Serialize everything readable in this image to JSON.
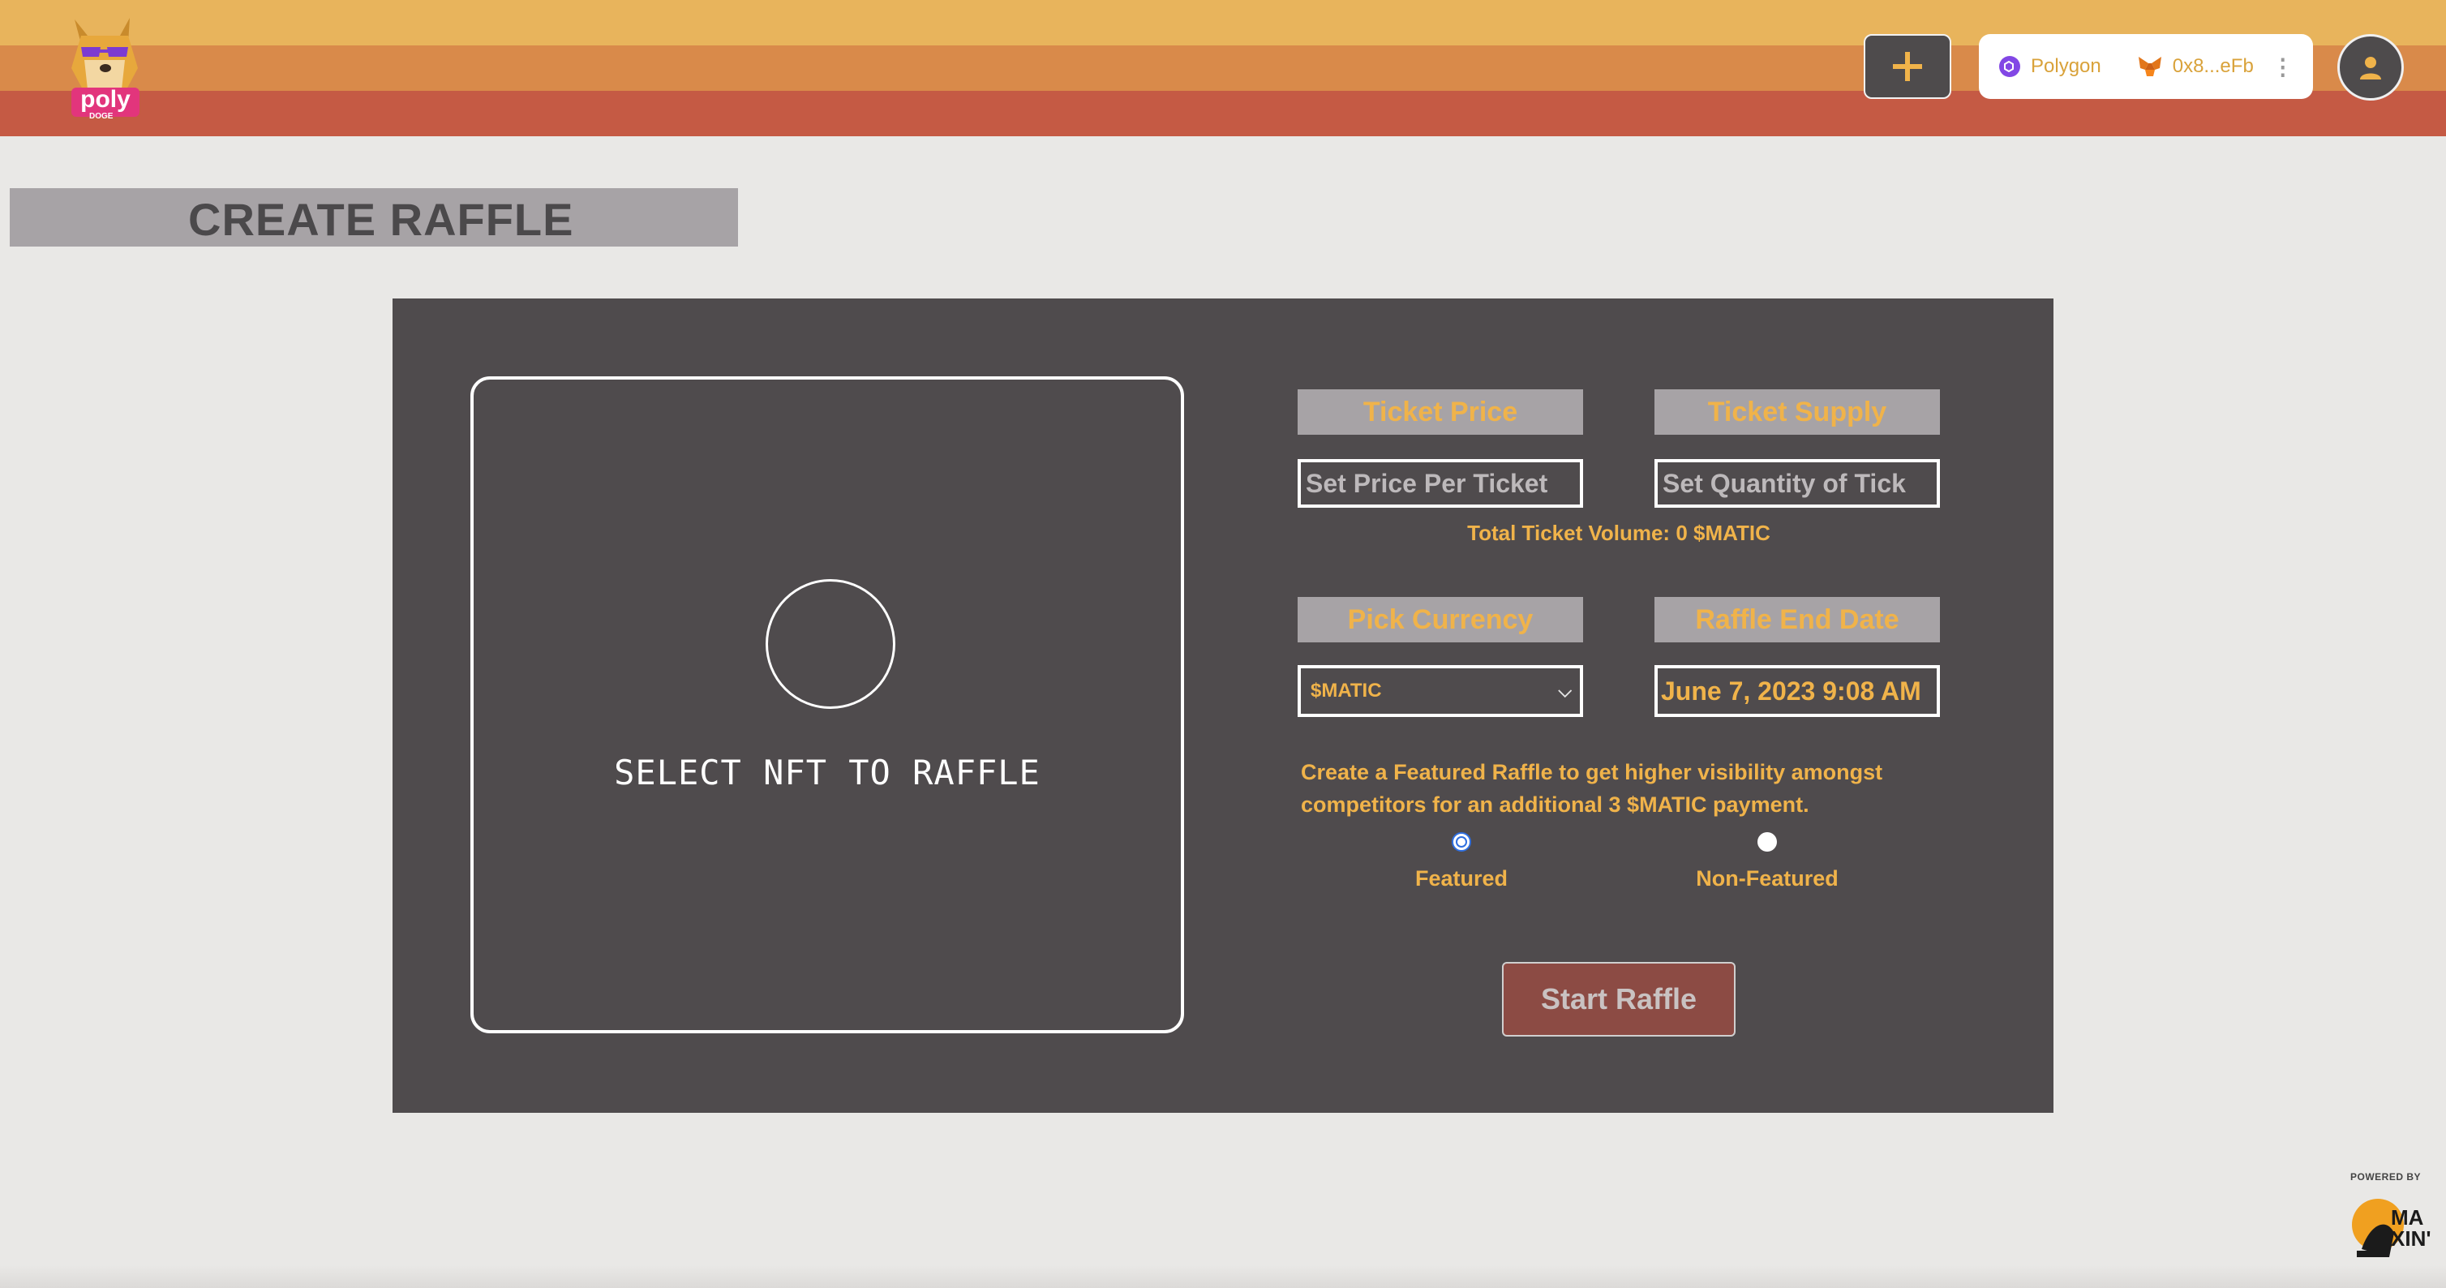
{
  "header": {
    "logo_text": "poly",
    "logo_subtext": "DOGE",
    "add_button_icon": "plus-icon",
    "wallet": {
      "network_name": "Polygon",
      "network_icon": "polygon-icon",
      "address": "0x8...eFb",
      "wallet_icon": "metamask-fox-icon",
      "menu_icon": "more-vertical-icon"
    },
    "avatar_icon": "user-icon"
  },
  "page": {
    "title": "CREATE RAFFLE"
  },
  "form": {
    "nft_select_label": "SELECT NFT TO RAFFLE",
    "ticket_price_label": "Ticket Price",
    "ticket_price_placeholder": "Set Price Per Ticket",
    "ticket_supply_label": "Ticket Supply",
    "ticket_supply_placeholder": "Set Quantity of Tick",
    "total_volume": "Total Ticket Volume: 0 $MATIC",
    "currency_label": "Pick Currency",
    "currency_selected": "$MATIC",
    "end_date_label": "Raffle End Date",
    "end_date_value": "June 7, 2023 9:08 AM",
    "featured_note": "Create a Featured Raffle to get higher visibility amongst competitors for an additional 3 $MATIC payment.",
    "featured_label": "Featured",
    "featured_checked": true,
    "non_featured_label": "Non-Featured",
    "non_featured_checked": false,
    "start_button": "Start Raffle"
  },
  "footer": {
    "powered_by": "POWERED BY",
    "powered_logo_text": "MA XIN'"
  },
  "colors": {
    "stripe_top": "#e8b45c",
    "stripe_mid": "#d98a4a",
    "stripe_bottom": "#c55a44",
    "panel": "#4f4b4d",
    "accent_text": "#f0b34a",
    "label_bg": "#a7a3a6",
    "start_button_bg": "#8c4b44"
  }
}
